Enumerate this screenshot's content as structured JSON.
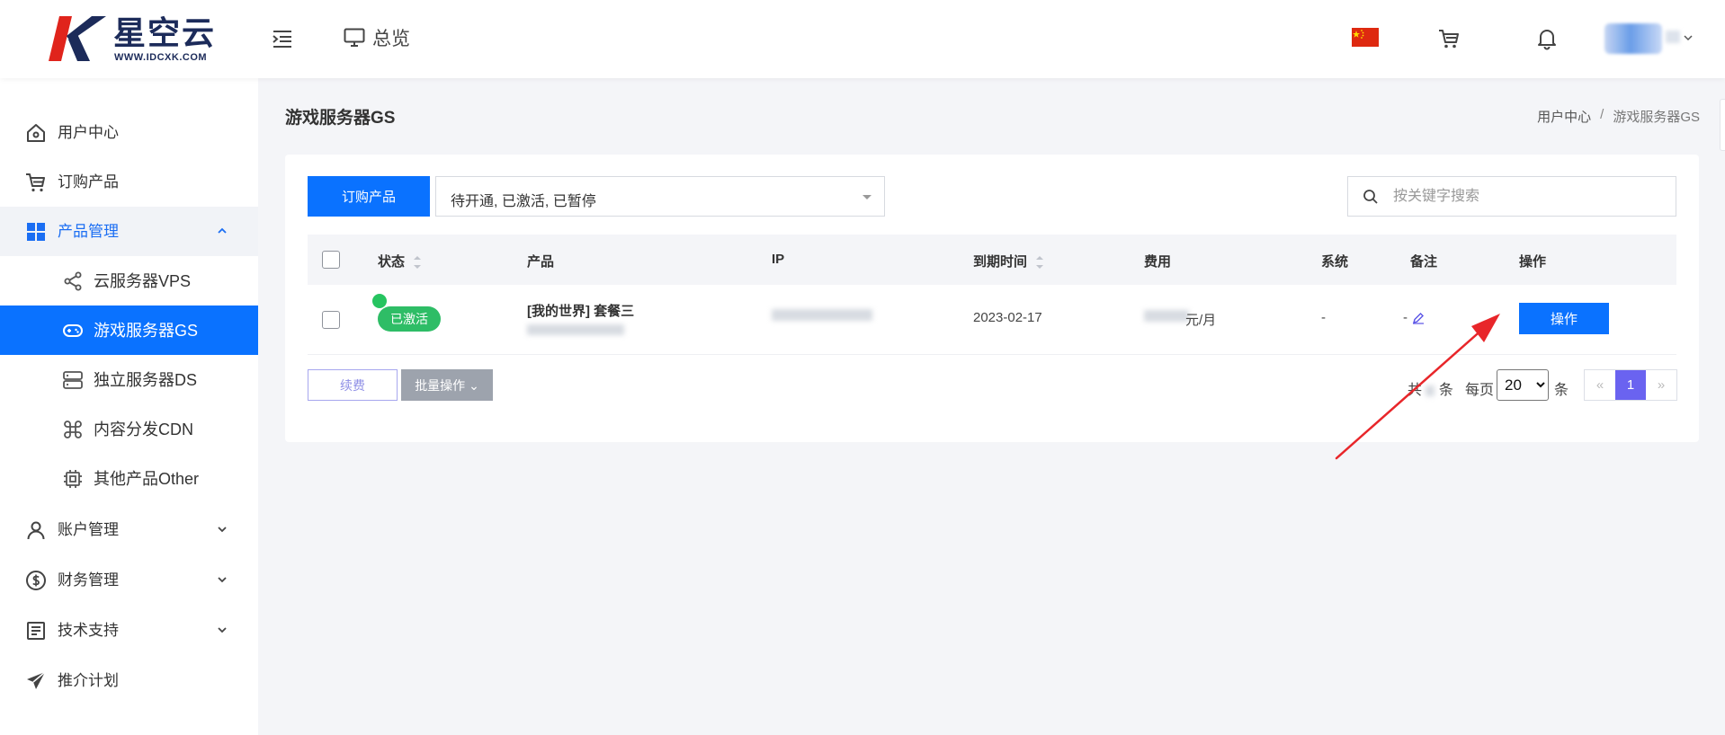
{
  "header": {
    "logo_name": "星空云",
    "logo_sub": "WWW.IDCXK.COM",
    "overview_label": "总览",
    "colors": {
      "accent": "#0a72ff",
      "logo_red": "#e0241c",
      "logo_navy": "#1c2b5a",
      "flag": "#de2910"
    },
    "icons": [
      "menu-indent-icon",
      "monitor-icon",
      "china-flag-icon",
      "cart-icon",
      "bell-icon",
      "avatar",
      "chevron-down-icon"
    ]
  },
  "sidebar": {
    "items": [
      {
        "label": "用户中心",
        "icon": "home-icon"
      },
      {
        "label": "订购产品",
        "icon": "cart-icon"
      },
      {
        "label": "产品管理",
        "icon": "grid-icon",
        "expanded": true
      },
      {
        "label": "云服务器VPS",
        "icon": "share-icon",
        "sub": true
      },
      {
        "label": "游戏服务器GS",
        "icon": "gamepad-icon",
        "sub": true,
        "active": true
      },
      {
        "label": "独立服务器DS",
        "icon": "server-icon",
        "sub": true
      },
      {
        "label": "内容分发CDN",
        "icon": "command-icon",
        "sub": true
      },
      {
        "label": "其他产品Other",
        "icon": "chip-icon",
        "sub": true
      },
      {
        "label": "账户管理",
        "icon": "user-icon"
      },
      {
        "label": "财务管理",
        "icon": "dollar-icon"
      },
      {
        "label": "技术支持",
        "icon": "ticket-icon"
      },
      {
        "label": "推介计划",
        "icon": "send-icon"
      }
    ]
  },
  "page": {
    "title": "游戏服务器GS",
    "breadcrumb": [
      "用户中心",
      "/",
      "游戏服务器GS"
    ]
  },
  "toolbar": {
    "order_label": "订购产品",
    "status_filter": "待开通, 已激活, 已暂停",
    "search_placeholder": "按关键字搜索"
  },
  "table": {
    "columns": [
      "状态",
      "产品",
      "IP",
      "到期时间",
      "费用",
      "系统",
      "备注",
      "操作"
    ],
    "rows": [
      {
        "status": "已激活",
        "product": "[我的世界] 套餐三",
        "expiry": "2023-02-17",
        "fee_unit": "元/月",
        "system": "-",
        "note": "-",
        "action": "操作"
      }
    ]
  },
  "footer": {
    "renew_label": "续费",
    "batch_label": "批量操作",
    "total_prefix": "共",
    "total_suffix": "条",
    "per_page_label": "每页",
    "per_page_value": "20",
    "per_page_unit": "条",
    "pages": [
      "«",
      "1",
      "»"
    ]
  }
}
